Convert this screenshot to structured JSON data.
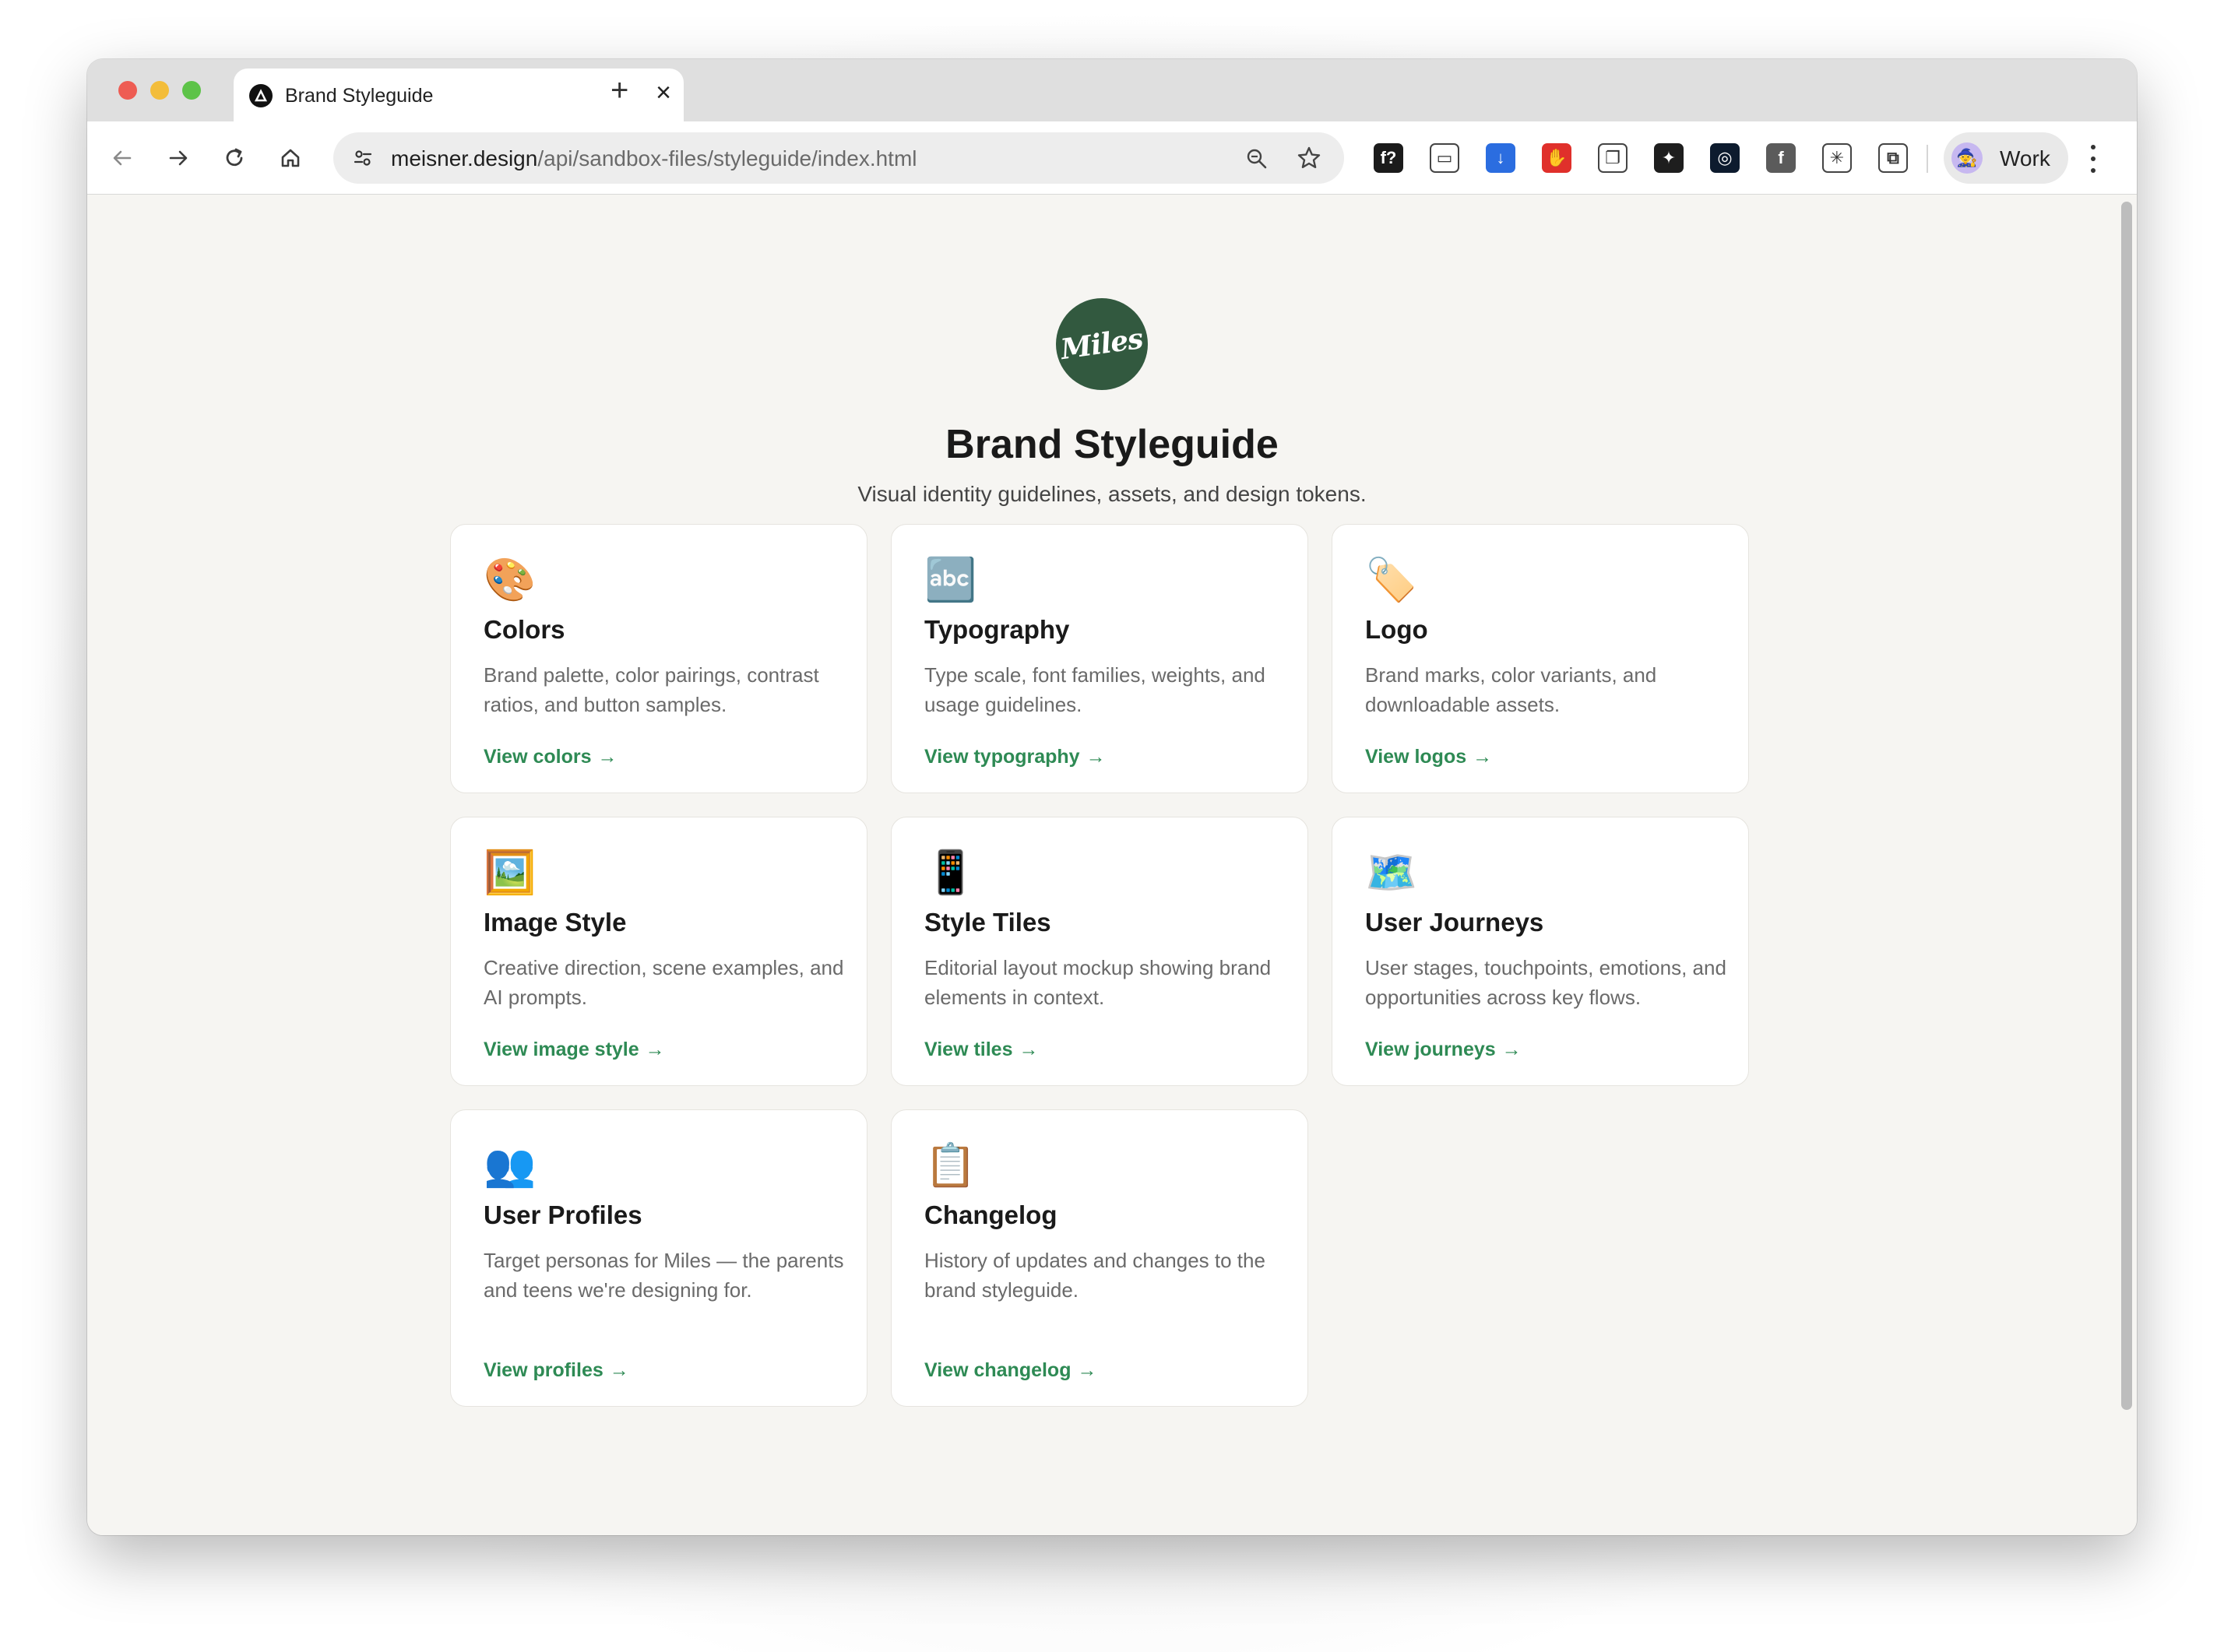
{
  "browser": {
    "tab_title": "Brand Styleguide",
    "tab_close": "×",
    "new_tab": "+",
    "url_host": "meisner.design",
    "url_path": "/api/sandbox-files/styleguide/index.html",
    "profile_label": "Work",
    "extensions": [
      {
        "icon": "font-icon",
        "glyph": "f?",
        "color": "#1b1b1b"
      },
      {
        "icon": "screenshot-icon",
        "glyph": "▭",
        "color": "#ffffff"
      },
      {
        "icon": "download-icon",
        "glyph": "↓",
        "color": "#2b6de0"
      },
      {
        "icon": "stop-icon",
        "glyph": "✋",
        "color": "#e0302b"
      },
      {
        "icon": "copy-icon",
        "glyph": "❐",
        "color": "#ffffff"
      },
      {
        "icon": "figma-icon",
        "glyph": "✦",
        "color": "#1e1e1e"
      },
      {
        "icon": "capture-icon",
        "glyph": "◎",
        "color": "#0d1b2e"
      },
      {
        "icon": "f-icon",
        "glyph": "f",
        "color": "#5b5b5b"
      },
      {
        "icon": "claude-icon",
        "glyph": "✳",
        "color": "#ffffff"
      },
      {
        "icon": "extensions-puzzle-icon",
        "glyph": "⧉",
        "color": "#ffffff"
      }
    ]
  },
  "page": {
    "logo_text": "Miles",
    "title": "Brand Styleguide",
    "subtitle": "Visual identity guidelines, assets, and design tokens."
  },
  "cards": [
    {
      "icon": "palette-icon",
      "emoji": "🎨",
      "title": "Colors",
      "desc": "Brand palette, color pairings, contrast ratios, and button samples.",
      "link": "View colors"
    },
    {
      "icon": "abc-icon",
      "emoji": "🔤",
      "title": "Typography",
      "desc": "Type scale, font families, weights, and usage guidelines.",
      "link": "View typography"
    },
    {
      "icon": "label-tag-icon",
      "emoji": "🏷️",
      "title": "Logo",
      "desc": "Brand marks, color variants, and downloadable assets.",
      "link": "View logos"
    },
    {
      "icon": "framed-picture-icon",
      "emoji": "🖼️",
      "title": "Image Style",
      "desc": "Creative direction, scene examples, and AI prompts.",
      "link": "View image style"
    },
    {
      "icon": "mobile-phone-icon",
      "emoji": "📱",
      "title": "Style Tiles",
      "desc": "Editorial layout mockup showing brand elements in context.",
      "link": "View tiles"
    },
    {
      "icon": "map-icon",
      "emoji": "🗺️",
      "title": "User Journeys",
      "desc": "User stages, touchpoints, emotions, and opportunities across key flows.",
      "link": "View journeys"
    },
    {
      "icon": "people-icon",
      "emoji": "👥",
      "title": "User Profiles",
      "desc": "Target personas for Miles — the parents and teens we're designing for.",
      "link": "View profiles"
    },
    {
      "icon": "clipboard-icon",
      "emoji": "📋",
      "title": "Changelog",
      "desc": "History of updates and changes to the brand styleguide.",
      "link": "View changelog"
    }
  ],
  "link_arrow": "→",
  "colors": {
    "accent": "#2e8a54",
    "logo_bg": "#32593f",
    "page_bg": "#f6f5f2"
  }
}
